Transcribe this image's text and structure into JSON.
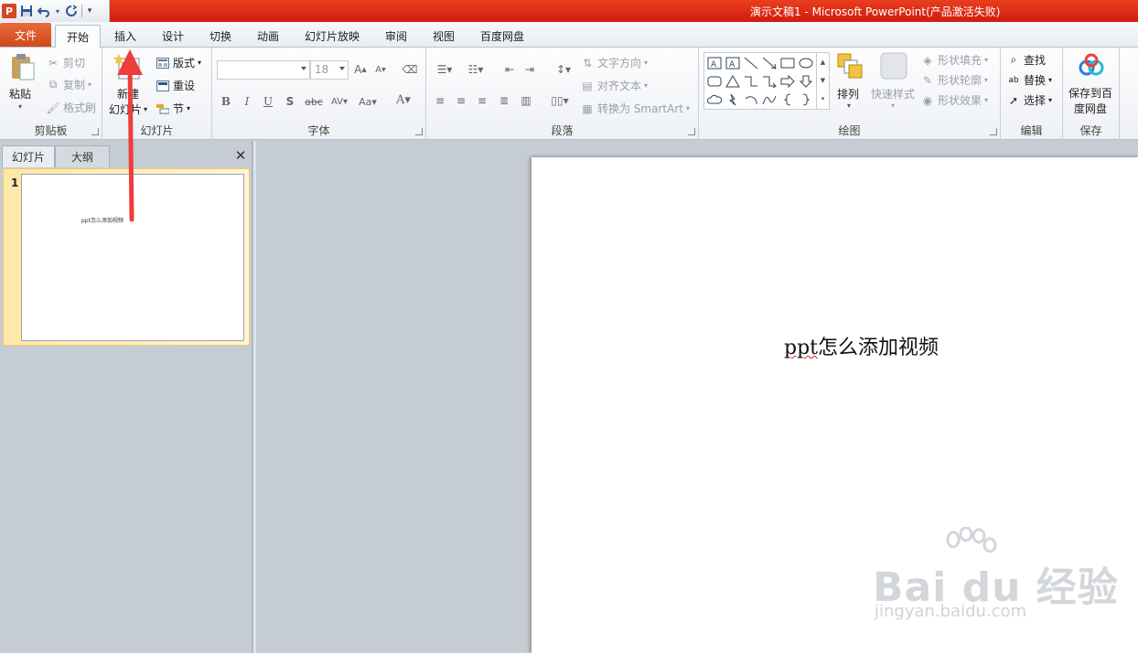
{
  "window": {
    "title": "演示文稿1 - Microsoft PowerPoint(产品激活失败)"
  },
  "qat": {
    "app_icon": "P"
  },
  "tabs": [
    {
      "label": "文件"
    },
    {
      "label": "开始"
    },
    {
      "label": "插入"
    },
    {
      "label": "设计"
    },
    {
      "label": "切换"
    },
    {
      "label": "动画"
    },
    {
      "label": "幻灯片放映"
    },
    {
      "label": "审阅"
    },
    {
      "label": "视图"
    },
    {
      "label": "百度网盘"
    }
  ],
  "ribbon": {
    "clipboard": {
      "label": "剪贴板",
      "paste": "粘贴",
      "cut": "剪切",
      "copy": "复制",
      "format_painter": "格式刷"
    },
    "slides": {
      "label": "幻灯片",
      "new_slide_1": "新建",
      "new_slide_2": "幻灯片",
      "layout": "版式",
      "reset": "重设",
      "section": "节"
    },
    "font": {
      "label": "字体",
      "font_name": "",
      "font_size": "18"
    },
    "paragraph": {
      "label": "段落",
      "text_direction": "文字方向",
      "align_text": "对齐文本",
      "convert_smartart": "转换为 SmartArt"
    },
    "drawing": {
      "label": "绘图",
      "arrange": "排列",
      "quick_styles": "快速样式",
      "shape_fill": "形状填充",
      "shape_outline": "形状轮廓",
      "shape_effects": "形状效果"
    },
    "editing": {
      "label": "编辑",
      "find": "查找",
      "replace": "替换",
      "select": "选择"
    },
    "save": {
      "label": "保存",
      "save_baidu_1": "保存到百",
      "save_baidu_2": "度网盘"
    }
  },
  "left_pane": {
    "tab_slides": "幻灯片",
    "tab_outline": "大纲",
    "close": "✕",
    "thumb_number": "1",
    "thumb_text": "ppt怎么添加视频"
  },
  "slide": {
    "text_latin": "ppt",
    "text_cjk": "怎么添加视频"
  },
  "watermark": {
    "main": "Bai du 经验",
    "sub": "jingyan.baidu.com"
  },
  "colors": {
    "title_bar": "#d21c0f",
    "file_tab": "#cf4a1c",
    "annotation_arrow": "#f03c3c"
  }
}
